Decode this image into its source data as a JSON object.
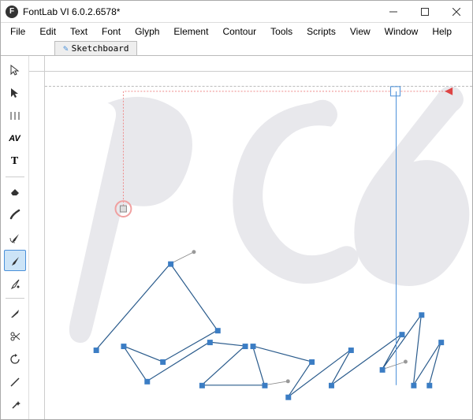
{
  "titlebar": {
    "app_icon_letter": "F",
    "title": "FontLab VI 6.0.2.6578*"
  },
  "menu": {
    "items": [
      "File",
      "Edit",
      "Text",
      "Font",
      "Glyph",
      "Element",
      "Contour",
      "Tools",
      "Scripts",
      "View",
      "Window",
      "Help"
    ]
  },
  "tabs": {
    "active": {
      "label": "Sketchboard"
    }
  },
  "tools": {
    "groups": [
      [
        "arrow-outline",
        "arrow-solid",
        "metrics-h",
        "metrics-av",
        "text-tool"
      ],
      [
        "eraser",
        "brush",
        "pen-curve",
        "pen-rapid",
        "pen-draw"
      ],
      [
        "knife",
        "scissors",
        "rotate",
        "line-tool",
        "magic-wand"
      ]
    ],
    "active": "pen-rapid"
  }
}
